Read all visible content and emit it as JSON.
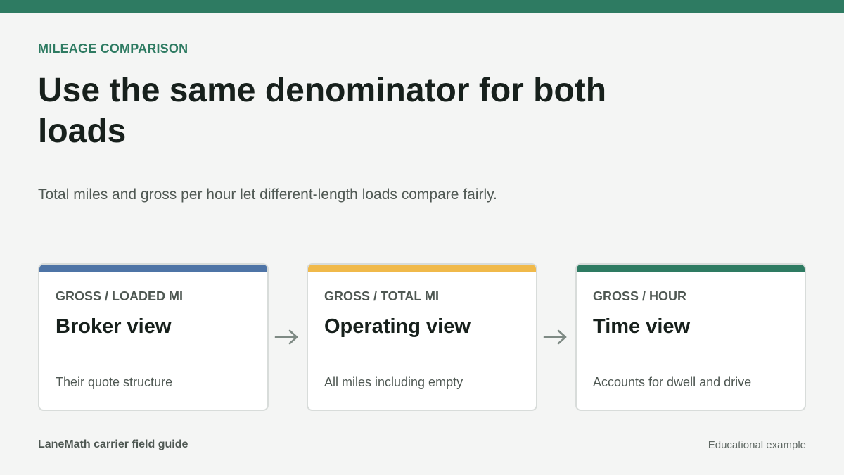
{
  "header": {
    "eyebrow": "MILEAGE COMPARISON",
    "title": "Use the same denominator for both loads",
    "subtitle": "Total miles and gross per hour let different-length loads compare fairly."
  },
  "cards": [
    {
      "label": "GROSS / LOADED MI",
      "title": "Broker view",
      "description": "Their quote structure",
      "accent_color": "#4e74a6"
    },
    {
      "label": "GROSS / TOTAL MI",
      "title": "Operating view",
      "description": "All miles including empty",
      "accent_color": "#f0b94a"
    },
    {
      "label": "GROSS / HOUR",
      "title": "Time view",
      "description": "Accounts for dwell and drive",
      "accent_color": "#2e7b62"
    }
  ],
  "icons": {
    "flow_arrow": "right-arrow-icon"
  },
  "footer": {
    "brand": "LaneMath carrier field guide",
    "note": "Educational example"
  },
  "colors": {
    "brand": "#2e7b62",
    "background": "#f4f5f4",
    "text": "#17201c",
    "muted": "#4f5853"
  }
}
